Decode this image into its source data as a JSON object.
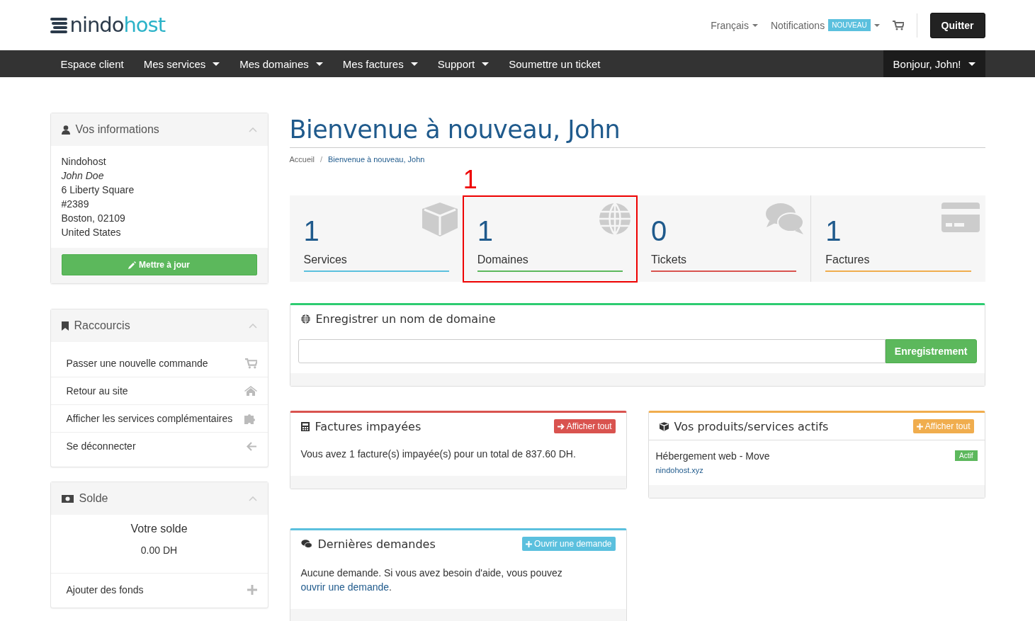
{
  "header": {
    "logo": {
      "text": "nindo",
      "accent": "host"
    },
    "language": "Français",
    "notifications": {
      "label": "Notifications",
      "badge": "NOUVEAU"
    },
    "logout": "Quitter"
  },
  "nav": {
    "items": [
      {
        "label": "Espace client",
        "dropdown": false
      },
      {
        "label": "Mes services",
        "dropdown": true
      },
      {
        "label": "Mes domaines",
        "dropdown": true
      },
      {
        "label": "Mes factures",
        "dropdown": true
      },
      {
        "label": "Support",
        "dropdown": true
      },
      {
        "label": "Soumettre un ticket",
        "dropdown": false
      }
    ],
    "account": "Bonjour, John!"
  },
  "sidebar": {
    "info": {
      "title": "Vos informations",
      "company": "Nindohost",
      "name": "John Doe",
      "address_lines": [
        "6 Liberty Square",
        "#2389",
        "Boston, 02109",
        "United States"
      ],
      "button": "Mettre à jour"
    },
    "shortcuts": {
      "title": "Raccourcis",
      "items": [
        "Passer une nouvelle commande",
        "Retour au site",
        "Afficher les services complémentaires",
        "Se déconnecter"
      ]
    },
    "balance": {
      "title": "Solde",
      "label": "Votre solde",
      "amount": "0.00 DH",
      "action": "Ajouter des fonds"
    }
  },
  "main": {
    "title": "Bienvenue à nouveau, John",
    "breadcrumb_separator": "/",
    "breadcrumb": [
      {
        "label": "Accueil",
        "selected": false
      },
      {
        "label": "Bienvenue à nouveau, John",
        "selected": true
      }
    ],
    "annotation": "1",
    "stats": [
      {
        "count": "1",
        "label": "Services",
        "color": "#5bc0de",
        "highlighted": false
      },
      {
        "count": "1",
        "label": "Domaines",
        "color": "#5cb85c",
        "highlighted": true
      },
      {
        "count": "0",
        "label": "Tickets",
        "color": "#d9534f",
        "highlighted": false
      },
      {
        "count": "1",
        "label": "Factures",
        "color": "#f0ad4e",
        "highlighted": false
      }
    ],
    "domain_panel": {
      "title": "Enregistrer un nom de domaine",
      "button": "Enregistrement"
    },
    "invoices_panel": {
      "title": "Factures impayées",
      "button": "Afficher tout",
      "text": "Vous avez 1 facture(s) impayée(s) pour un total de 837.60 DH."
    },
    "products_panel": {
      "title": "Vos produits/services actifs",
      "button": "Afficher tout",
      "items": [
        {
          "name": "Hébergement web - Move",
          "domain": "nindohost.xyz",
          "status": "Actif"
        }
      ]
    },
    "tickets_panel": {
      "title": "Dernières demandes",
      "button": "Ouvrir une demande",
      "text": "Aucune demande. Si vous avez besoin d'aide, vous pouvez",
      "link": "ouvrir une demande",
      "end": "."
    }
  }
}
